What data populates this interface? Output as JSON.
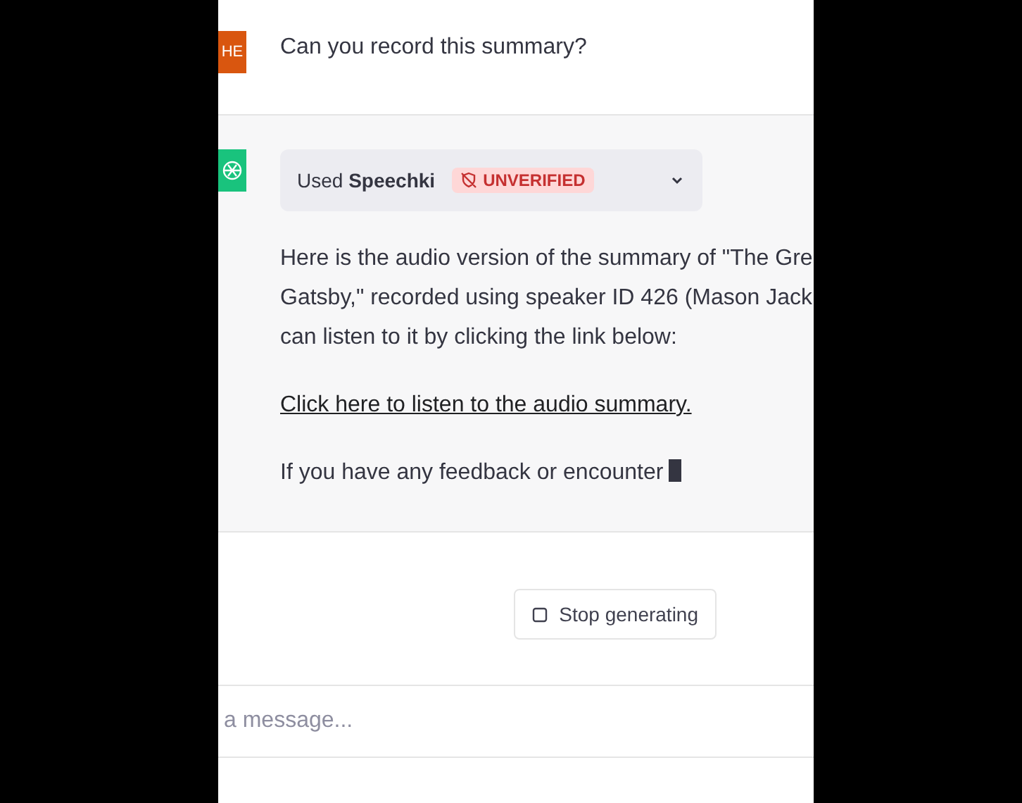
{
  "user_message": {
    "avatar": "HE",
    "text": "Can you record this summary?"
  },
  "assistant_message": {
    "plugin": {
      "prefix": "Used",
      "name": "Speechki",
      "badge": "UNVERIFIED",
      "expanded": false
    },
    "lines": [
      "Here is the audio version of the summary of \"The Gre",
      "Gatsby,\" recorded using speaker ID 426 (Mason Jack",
      "can listen to it by clicking the link below:"
    ],
    "link": "Click here to listen to the audio summary.",
    "partial": "If you have any feedback or encounter"
  },
  "stop_button": "Stop generating",
  "composer": {
    "placeholder": "a message..."
  }
}
